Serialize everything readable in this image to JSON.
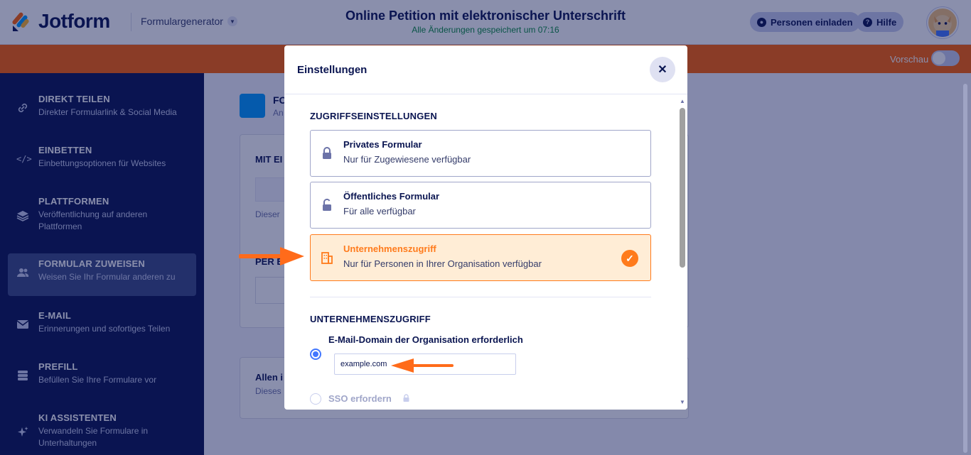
{
  "topbar": {
    "logo_text": "Jotform",
    "form_generator": "Formulargenerator",
    "form_title": "Online Petition mit elektronischer Unterschrift",
    "saved_note": "Alle Änderungen gespeichert um 07:16",
    "invite_label": "Personen einladen",
    "help_label": "Hilfe",
    "preview_label": "Vorschau",
    "brand_color": "#ff6100"
  },
  "sidebar": {
    "items": [
      {
        "title": "DIREKT TEILEN",
        "subtitle": "Direkter Formularlink & Social Media",
        "icon": "link-icon"
      },
      {
        "title": "EINBETTEN",
        "subtitle": "Einbettungsoptionen für Websites",
        "icon": "code-icon"
      },
      {
        "title": "PLATTFORMEN",
        "subtitle": "Veröffentlichung auf anderen Plattformen",
        "icon": "layers-icon"
      },
      {
        "title": "FORMULAR ZUWEISEN",
        "subtitle": "Weisen Sie Ihr Formular anderen zu",
        "icon": "users-icon",
        "active": true
      },
      {
        "title": "E-MAIL",
        "subtitle": "Erinnerungen und sofortiges Teilen",
        "icon": "envelope-icon"
      },
      {
        "title": "PREFILL",
        "subtitle": "Befüllen Sie Ihre Formulare vor",
        "icon": "database-icon"
      },
      {
        "title": "KI ASSISTENTEN",
        "subtitle": "Verwandeln Sie Formulare in Unterhaltungen",
        "icon": "sparkle-icon"
      }
    ]
  },
  "main": {
    "head_title": "FO",
    "head_sub": "An",
    "card1_title": "MIT EI",
    "card1_note": "Dieser",
    "card1_title2": "PER E",
    "card2_title": "Allen i",
    "card2_sub": "Dieses"
  },
  "modal": {
    "title": "Einstellungen",
    "access_section": "ZUGRIFFSEINSTELLUNGEN",
    "options": [
      {
        "title": "Privates Formular",
        "subtitle": "Nur für Zugewiesene verfügbar",
        "icon": "lock-icon",
        "selected": false
      },
      {
        "title": "Öffentliches Formular",
        "subtitle": "Für alle verfügbar",
        "icon": "unlock-icon",
        "selected": false
      },
      {
        "title": "Unternehmenszugriff",
        "subtitle": "Nur für Personen in Ihrer Organisation verfügbar",
        "icon": "building-icon",
        "selected": true
      }
    ],
    "company_section": "UNTERNEHMENSZUGRIFF",
    "radio_domain_label": "E-Mail-Domain der Organisation erforderlich",
    "domain_value": "example.com",
    "radio_sso_label": "SSO erfordern",
    "accent_color": "#ff7b1c",
    "radio_color": "#4277ff"
  }
}
